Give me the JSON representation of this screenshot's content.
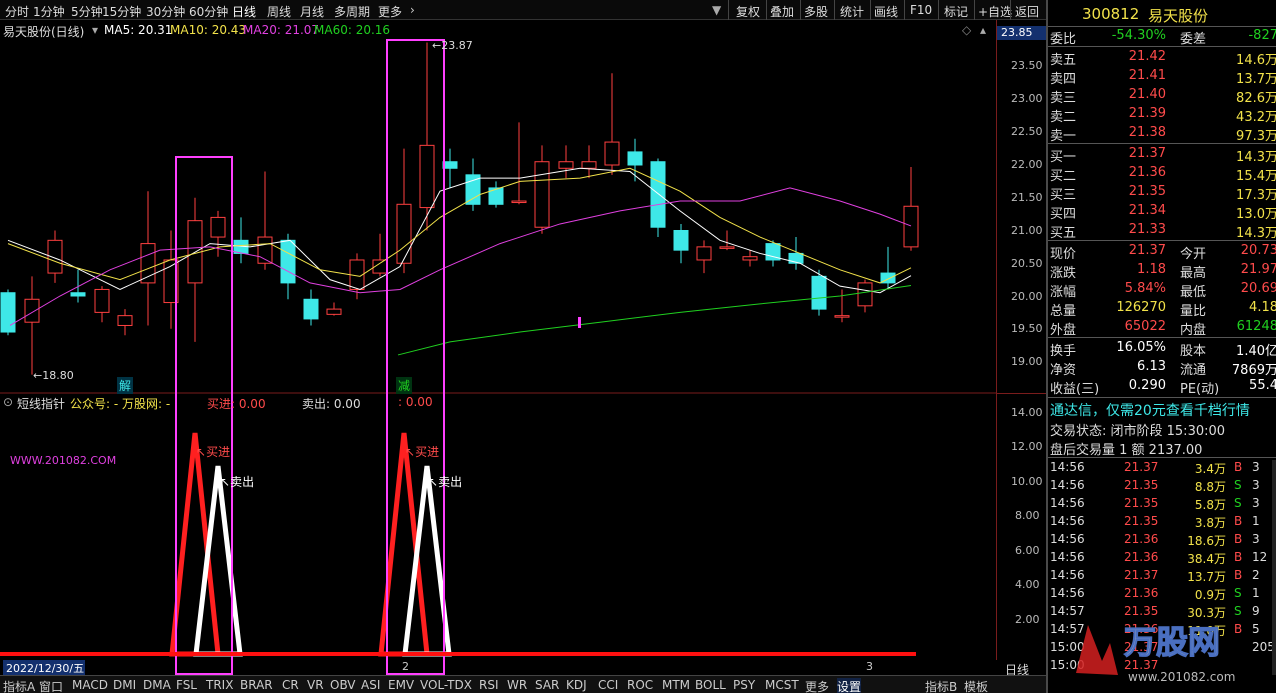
{
  "toolbar": {
    "periods": [
      "分时",
      "1分钟",
      "5分钟",
      "15分钟",
      "30分钟",
      "60分钟",
      "日线",
      "周线",
      "月线",
      "多周期",
      "更多"
    ],
    "buttons": [
      "复权",
      "叠加",
      "多股",
      "统计",
      "画线",
      "F10",
      "标记",
      "+自选",
      "返回"
    ]
  },
  "chart": {
    "name": "易天股份(日线)",
    "ma": [
      {
        "label": "MA5: 20.31",
        "color": "#ffffff"
      },
      {
        "label": "MA10: 20.43",
        "color": "#f2e24a"
      },
      {
        "label": "MA20: 21.07",
        "color": "#e040e0"
      },
      {
        "label": "MA60: 20.16",
        "color": "#20d020"
      }
    ],
    "current_price": "23.85",
    "yticks": [
      "23.50",
      "23.00",
      "22.50",
      "22.00",
      "21.50",
      "21.00",
      "20.50",
      "20.00",
      "19.50",
      "19.00"
    ],
    "high_label": "23.87",
    "low_label": "18.80",
    "mark_jie": "解",
    "mark_jian": "减"
  },
  "indicator": {
    "title": "短线指针",
    "gzh": "公众号: - 万股网: -",
    "buy": "买进: 0.00",
    "sell": "卖出: 0.00",
    "zero": ": 0.00",
    "site": "WWW.201082.COM",
    "buy_label": "买进",
    "sell_label": "卖出",
    "yticks": [
      "14.00",
      "12.00",
      "10.00",
      "8.00",
      "6.00",
      "4.00",
      "2.00"
    ],
    "axis_period": "日线"
  },
  "footer": {
    "date": "2022/12/30/五",
    "mark2": "2",
    "mark3": "3",
    "tabs": [
      "指标A",
      "窗口",
      "MACD",
      "DMI",
      "DMA",
      "FSL",
      "TRIX",
      "BRAR",
      "CR",
      "VR",
      "OBV",
      "ASI",
      "EMV",
      "VOL-TDX",
      "RSI",
      "WR",
      "SAR",
      "KDJ",
      "CCI",
      "ROC",
      "MTM",
      "BOLL",
      "PSY",
      "MCST",
      "更多",
      "设置"
    ],
    "right_tabs": [
      "指标B",
      "模板"
    ]
  },
  "quote": {
    "code": "300812",
    "name": "易天股份",
    "weibi_label": "委比",
    "weibi": "-54.30%",
    "weicha_label": "委差",
    "weicha": "-827",
    "sells": [
      {
        "label": "卖五",
        "price": "21.42",
        "vol": "14.6万"
      },
      {
        "label": "卖四",
        "price": "21.41",
        "vol": "13.7万"
      },
      {
        "label": "卖三",
        "price": "21.40",
        "vol": "82.6万"
      },
      {
        "label": "卖二",
        "price": "21.39",
        "vol": "43.2万"
      },
      {
        "label": "卖一",
        "price": "21.38",
        "vol": "97.3万"
      }
    ],
    "buys": [
      {
        "label": "买一",
        "price": "21.37",
        "vol": "14.3万"
      },
      {
        "label": "买二",
        "price": "21.36",
        "vol": "15.4万"
      },
      {
        "label": "买三",
        "price": "21.35",
        "vol": "17.3万"
      },
      {
        "label": "买四",
        "price": "21.34",
        "vol": "13.0万"
      },
      {
        "label": "买五",
        "price": "21.33",
        "vol": "14.3万"
      }
    ],
    "stats": [
      {
        "l1": "现价",
        "v1": "21.37",
        "l2": "今开",
        "v2": "20.73"
      },
      {
        "l1": "涨跌",
        "v1": "1.18",
        "l2": "最高",
        "v2": "21.97"
      },
      {
        "l1": "涨幅",
        "v1": "5.84%",
        "l2": "最低",
        "v2": "20.69"
      },
      {
        "l1": "总量",
        "v1": "126270",
        "l2": "量比",
        "v2": "4.18"
      },
      {
        "l1": "外盘",
        "v1": "65022",
        "l2": "内盘",
        "v2": "61248"
      }
    ],
    "stats2": [
      {
        "l1": "换手",
        "v1": "16.05%",
        "l2": "股本",
        "v2": "1.40亿"
      },
      {
        "l1": "净资",
        "v1": "6.13",
        "l2": "流通",
        "v2": "7869万"
      },
      {
        "l1": "收益(三)",
        "v1": "0.290",
        "l2": "PE(动)",
        "v2": "55.4"
      }
    ],
    "promo": "通达信，仅需20元查看千档行情",
    "status": "交易状态: 闭市阶段 15:30:00",
    "after": "盘后交易量 1 额 2137.00",
    "ticks": [
      {
        "t": "14:56",
        "p": "21.37",
        "v": "3.4万",
        "s": "B",
        "n": "3"
      },
      {
        "t": "14:56",
        "p": "21.35",
        "v": "8.8万",
        "s": "S",
        "n": "3"
      },
      {
        "t": "14:56",
        "p": "21.35",
        "v": "5.8万",
        "s": "S",
        "n": "3"
      },
      {
        "t": "14:56",
        "p": "21.35",
        "v": "3.8万",
        "s": "B",
        "n": "1"
      },
      {
        "t": "14:56",
        "p": "21.36",
        "v": "18.6万",
        "s": "B",
        "n": "3"
      },
      {
        "t": "14:56",
        "p": "21.36",
        "v": "38.4万",
        "s": "B",
        "n": "12"
      },
      {
        "t": "14:56",
        "p": "21.37",
        "v": "13.7万",
        "s": "B",
        "n": "2"
      },
      {
        "t": "14:56",
        "p": "21.36",
        "v": "0.9万",
        "s": "S",
        "n": "1"
      },
      {
        "t": "14:57",
        "p": "21.35",
        "v": "30.3万",
        "s": "S",
        "n": "9"
      },
      {
        "t": "14:57",
        "p": "21.36",
        "v": "11.0万",
        "s": "B",
        "n": "5"
      },
      {
        "t": "15:00",
        "p": "21.37",
        "v": "",
        "s": "",
        "n": "205"
      },
      {
        "t": "15:00",
        "p": "21.37",
        "v": "",
        "s": "",
        "n": ""
      }
    ],
    "logo_text": "万股网",
    "logo_url": "www.201082.com"
  },
  "colors": {
    "up": "#ff4040",
    "down": "#3ee8e8",
    "highlight": "#ff40ff",
    "accent": "#f2e24a"
  }
}
